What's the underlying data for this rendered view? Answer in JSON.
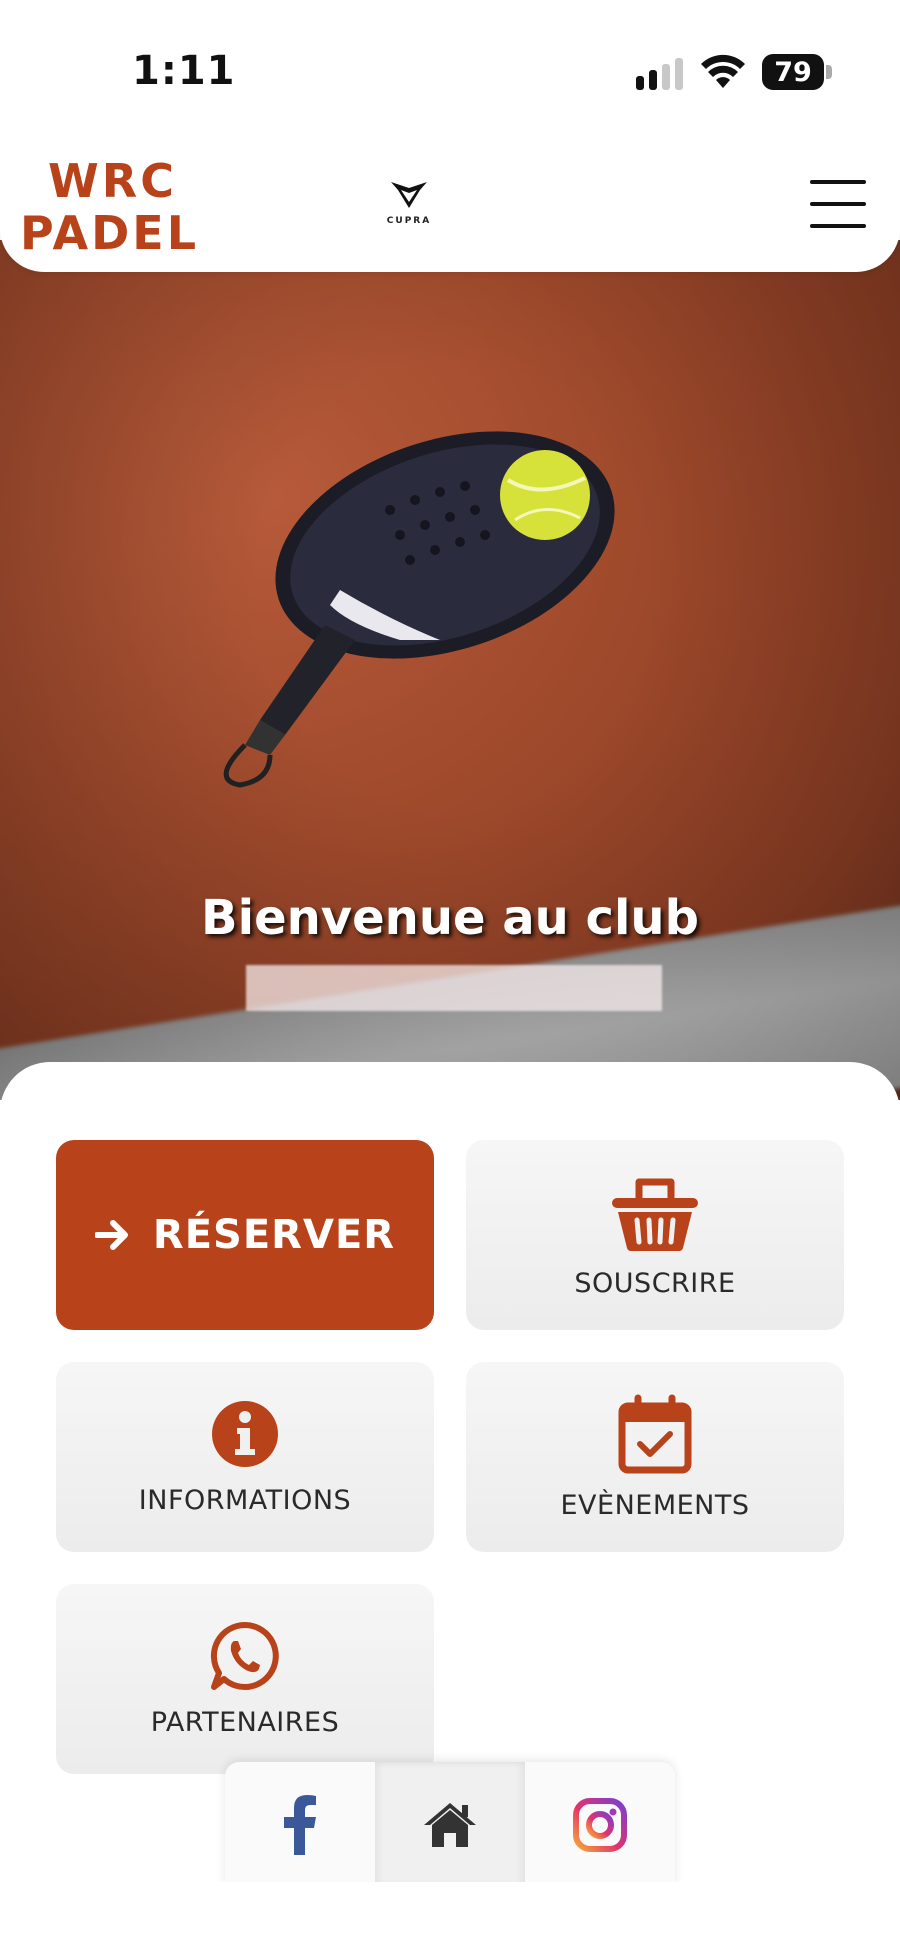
{
  "status_bar": {
    "time": "1:11",
    "battery": "79"
  },
  "header": {
    "logo_line1": "WRC",
    "logo_line2": "PADEL",
    "sponsor": "CUPRA",
    "menu_icon": "hamburger-menu-icon"
  },
  "hero": {
    "title": "Bienvenue au club"
  },
  "tiles": [
    {
      "label": "RÉSERVER",
      "icon": "arrow-right-icon",
      "style": "primary"
    },
    {
      "label": "SOUSCRIRE",
      "icon": "basket-icon"
    },
    {
      "label": "INFORMATIONS",
      "icon": "info-icon"
    },
    {
      "label": "EVÈNEMENTS",
      "icon": "calendar-check-icon"
    },
    {
      "label": "PARTENAIRES",
      "icon": "whatsapp-icon"
    }
  ],
  "social": [
    {
      "icon": "facebook-icon"
    },
    {
      "icon": "home-icon"
    },
    {
      "icon": "instagram-icon"
    }
  ],
  "colors": {
    "accent": "#b8431a",
    "tile_bg": "#eeeeee",
    "facebook": "#3b5998"
  }
}
